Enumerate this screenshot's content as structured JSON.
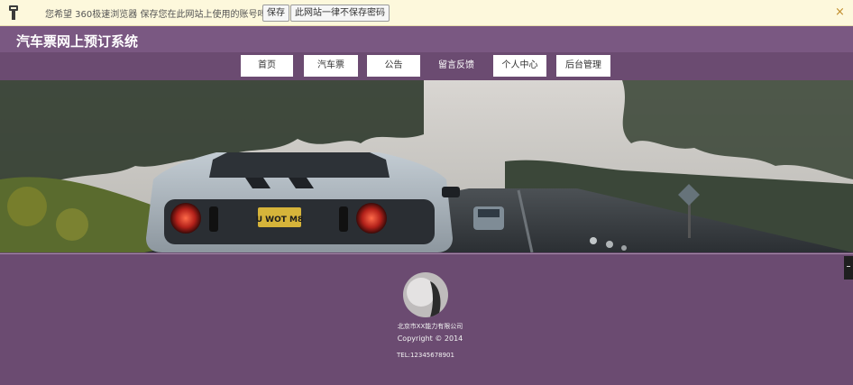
{
  "password_bar": {
    "message": "您希望 360极速浏览器 保存您在此网站上使用的账号吗?",
    "save_label": "保存",
    "never_label": "此网站一律不保存密码",
    "close_glyph": "×"
  },
  "header": {
    "site_title": "汽车票网上预订系统"
  },
  "nav": {
    "items": [
      {
        "label": "首页"
      },
      {
        "label": "汽车票"
      },
      {
        "label": "公告"
      },
      {
        "label": "留言反馈"
      },
      {
        "label": "个人中心"
      },
      {
        "label": "后台管理"
      }
    ]
  },
  "hero": {
    "plate_text": "U WOT M8",
    "prev_glyph": "‹",
    "next_glyph": "‹"
  },
  "footer": {
    "company": "北京市XX能力有限公司",
    "copyright": "Copyright © 2014",
    "tel": "TEL:12345678901"
  },
  "colors": {
    "header_bg": "#7a5882",
    "nav_bg": "#6b4b71",
    "footer_bg": "#6b4b71",
    "password_bar_bg": "#fdf8dc"
  }
}
